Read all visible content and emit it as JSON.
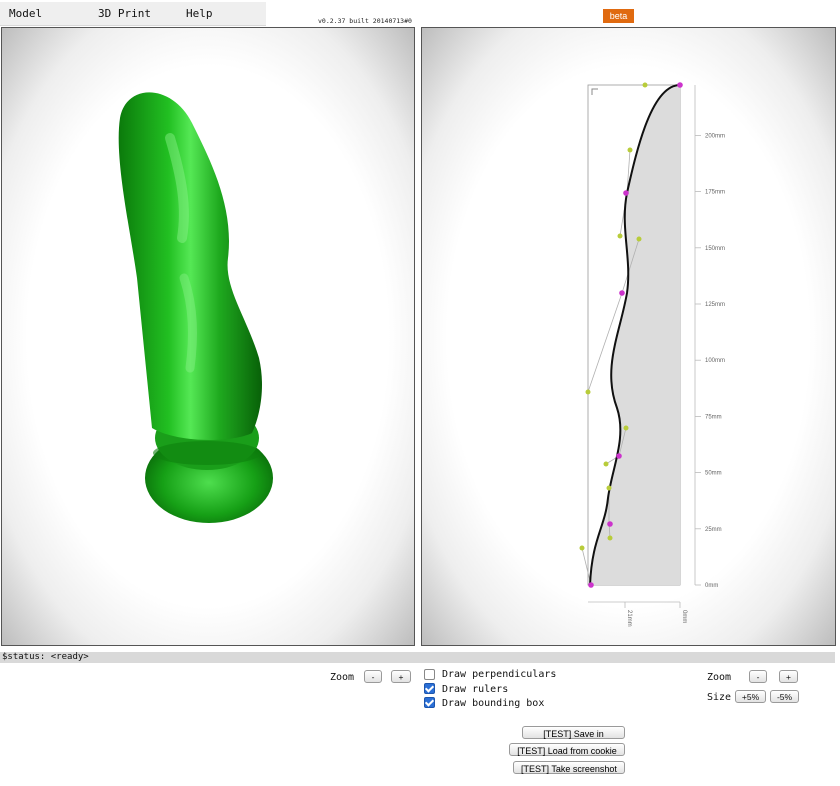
{
  "menu": {
    "items": [
      "Model",
      "3D Print",
      "Help"
    ]
  },
  "version": "v0.2.37 built 20140713#0",
  "beta_label": "beta",
  "colors": {
    "model": "#1a9e1a",
    "control_point": "#b8cc3a",
    "curve_point": "#cc33cc",
    "beta_bg": "#e06a10"
  },
  "ruler": {
    "y_ticks": [
      "0mm",
      "25mm",
      "50mm",
      "75mm",
      "100mm",
      "125mm",
      "150mm",
      "175mm",
      "200mm"
    ],
    "x_ticks": [
      "21mm",
      "0mm"
    ]
  },
  "status": "$status: <ready>",
  "left_controls": {
    "zoom_label": "Zoom",
    "zoom_out": "-",
    "zoom_in": "+"
  },
  "options": [
    {
      "label": "Draw perpendiculars",
      "checked": false
    },
    {
      "label": "Draw rulers",
      "checked": true
    },
    {
      "label": "Draw bounding box",
      "checked": true
    }
  ],
  "right_controls": {
    "zoom_label": "Zoom",
    "zoom_out": "-",
    "zoom_in": "+",
    "size_label": "Size",
    "size_up": "+5%",
    "size_down": "-5%"
  },
  "test_buttons": [
    "[TEST] Save in cookie",
    "[TEST] Load from cookie",
    "[TEST] Take screenshot"
  ]
}
